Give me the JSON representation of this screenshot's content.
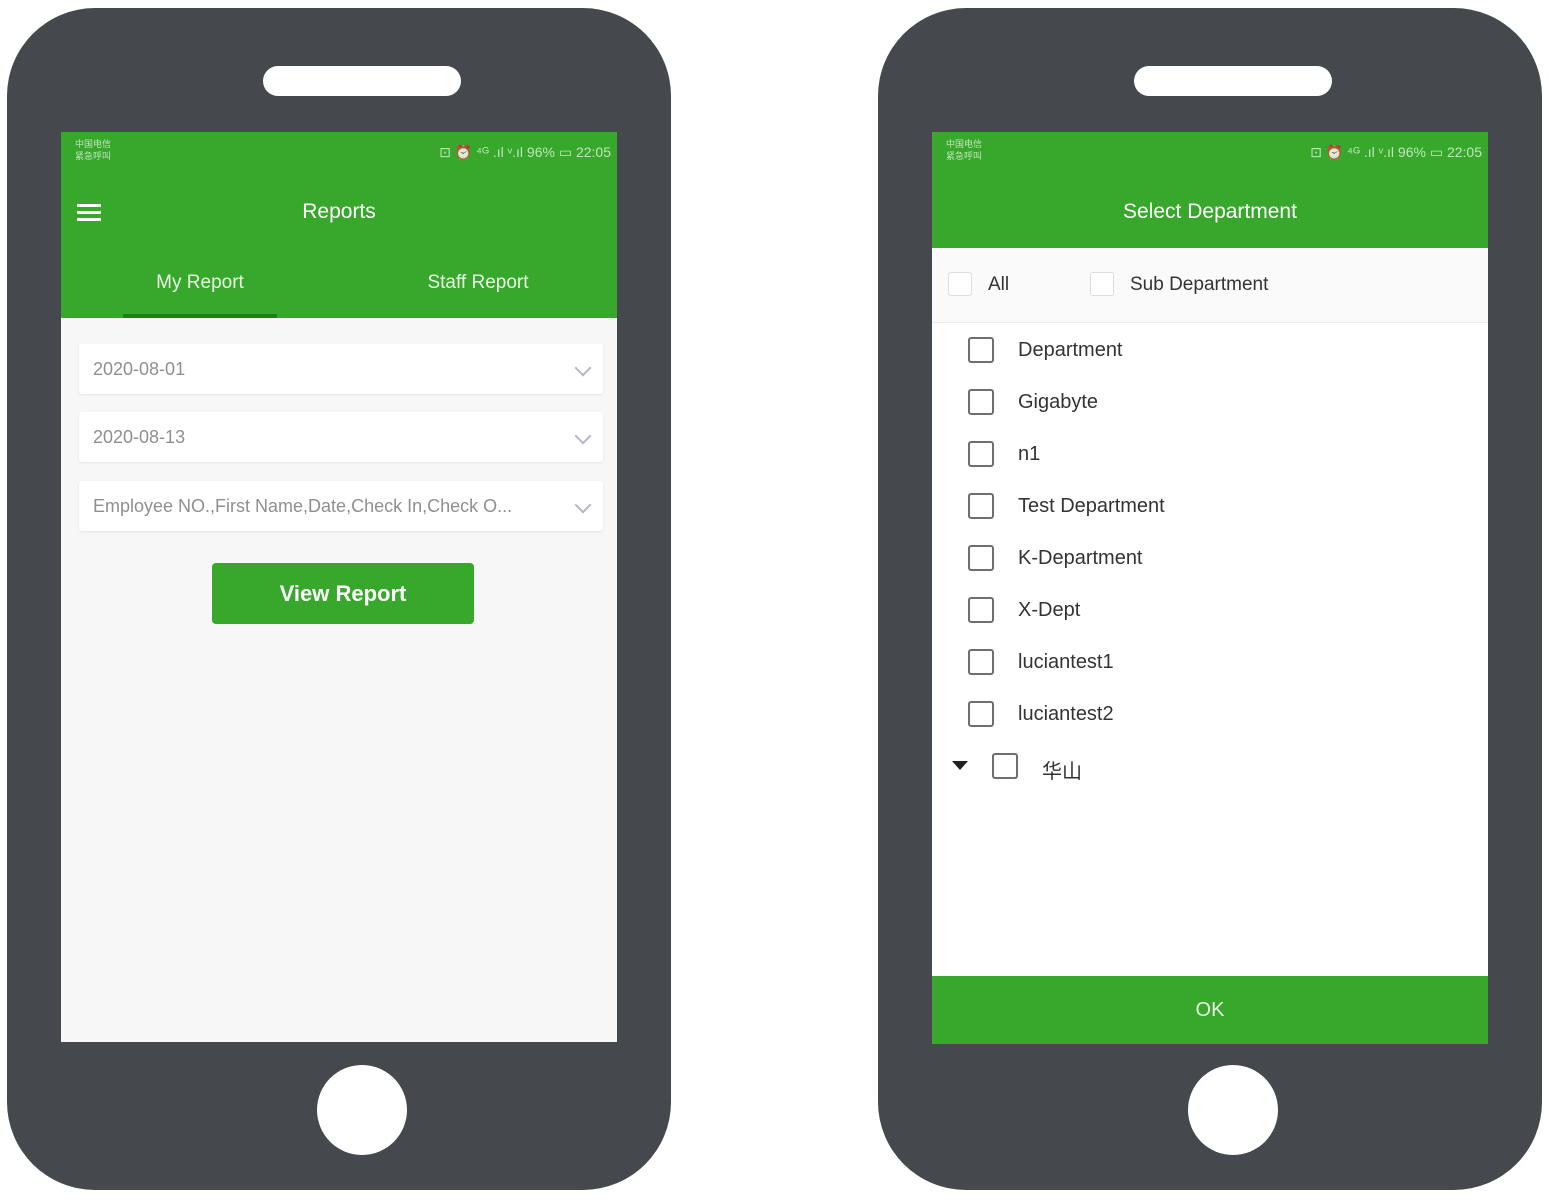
{
  "left_phone": {
    "status": {
      "carrier_line1": "中国电信",
      "carrier_line2": "紧急呼叫",
      "right": "⊡ ⏰ ⁴ᴳ .ıl ᵛ.ıl 96% ▭ 22:05"
    },
    "title": "Reports",
    "tabs": [
      {
        "label": "My Report",
        "active": true
      },
      {
        "label": "Staff Report",
        "active": false
      }
    ],
    "start_date": "2020-08-01",
    "end_date": "2020-08-13",
    "columns": "Employee NO.,First Name,Date,Check In,Check O...",
    "view_button": "View Report"
  },
  "right_phone": {
    "status": {
      "carrier_line1": "中国电信",
      "carrier_line2": "紧急呼叫",
      "right": "⊡ ⏰ ⁴ᴳ .ıl ᵛ.ıl 96% ▭ 22:05"
    },
    "title": "Select Department",
    "filter_all": "All",
    "filter_sub": "Sub Department",
    "departments": [
      "Department",
      "Gigabyte",
      "n1",
      "Test Department",
      "K-Department",
      "X-Dept",
      "luciantest1",
      "luciantest2"
    ],
    "expandable_dept": "华山",
    "ok_button": "OK"
  },
  "colors": {
    "brand_green": "#37a82b",
    "phone_body": "#45484d"
  }
}
